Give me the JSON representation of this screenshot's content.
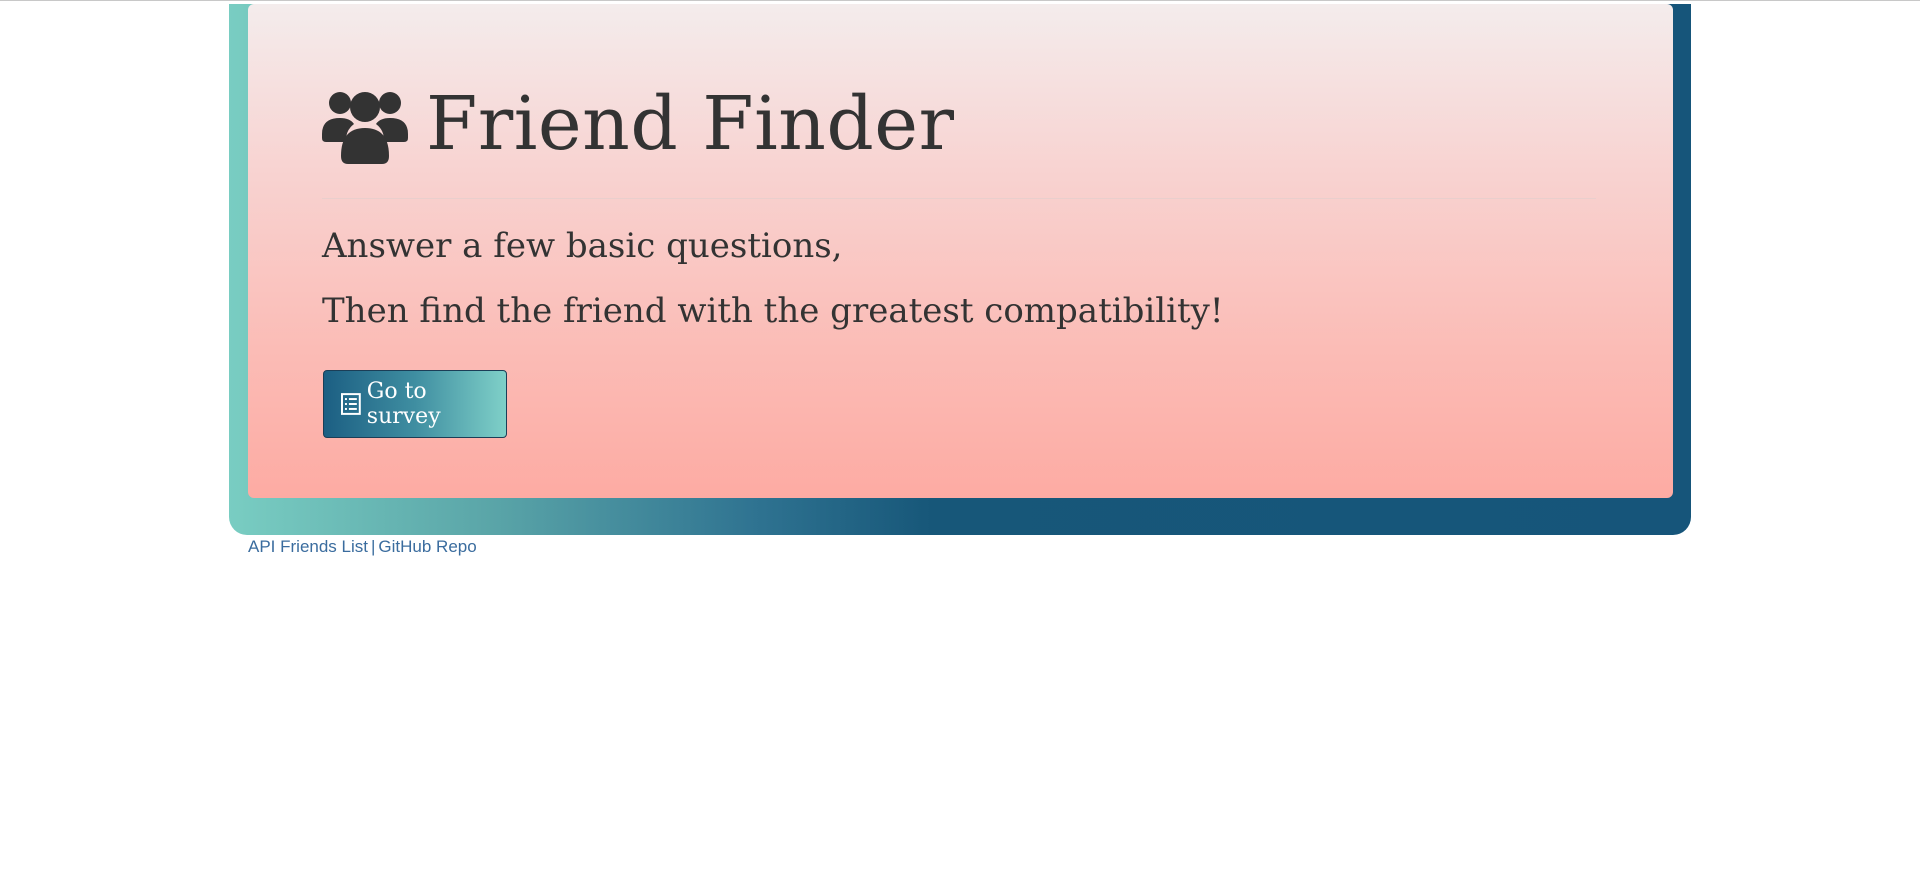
{
  "header": {
    "title": "Friend Finder",
    "icon": "users-icon"
  },
  "intro": {
    "line1": "Answer a few basic questions,",
    "line2": "Then find the friend with the greatest compatibility!"
  },
  "actions": {
    "survey_label": "Go to survey",
    "survey_icon": "list-icon"
  },
  "footer": {
    "api_link": "API Friends List",
    "separator": "|",
    "repo_link": "GitHub Repo"
  },
  "colors": {
    "text": "#333333",
    "link": "#3a6c9e",
    "jumbotron_top": "#f4ecec",
    "jumbotron_bottom": "#fdaba3",
    "frame_teal": "#79cdc2",
    "frame_navy": "#16557a"
  }
}
